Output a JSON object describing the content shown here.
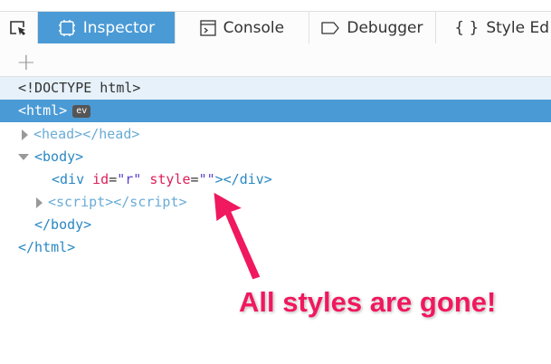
{
  "toolbar": {
    "tabs": [
      {
        "label": "Inspector",
        "icon": "inspector-icon",
        "active": true
      },
      {
        "label": "Console",
        "icon": "console-icon"
      },
      {
        "label": "Debugger",
        "icon": "debugger-icon"
      },
      {
        "label": "Style Ed",
        "icon": "braces-icon"
      }
    ]
  },
  "tree": {
    "doctype": "<!DOCTYPE html>",
    "html_open": "<html>",
    "badge": "ev",
    "head_open": "<head>",
    "head_close": "</head>",
    "body_open": "<body>",
    "div_open": "<div",
    "div_id_attr": "id",
    "div_id_val": "\"r\"",
    "div_style_attr": "style",
    "div_style_val": "\"\"",
    "div_close": "></div>",
    "script_open": "<script>",
    "script_close": "</script>",
    "body_close": "</body>",
    "html_close": "</html>"
  },
  "annotation": {
    "text": "All styles are gone!",
    "color": "#f0185f"
  },
  "colors": {
    "accent": "#4a9ad6"
  }
}
